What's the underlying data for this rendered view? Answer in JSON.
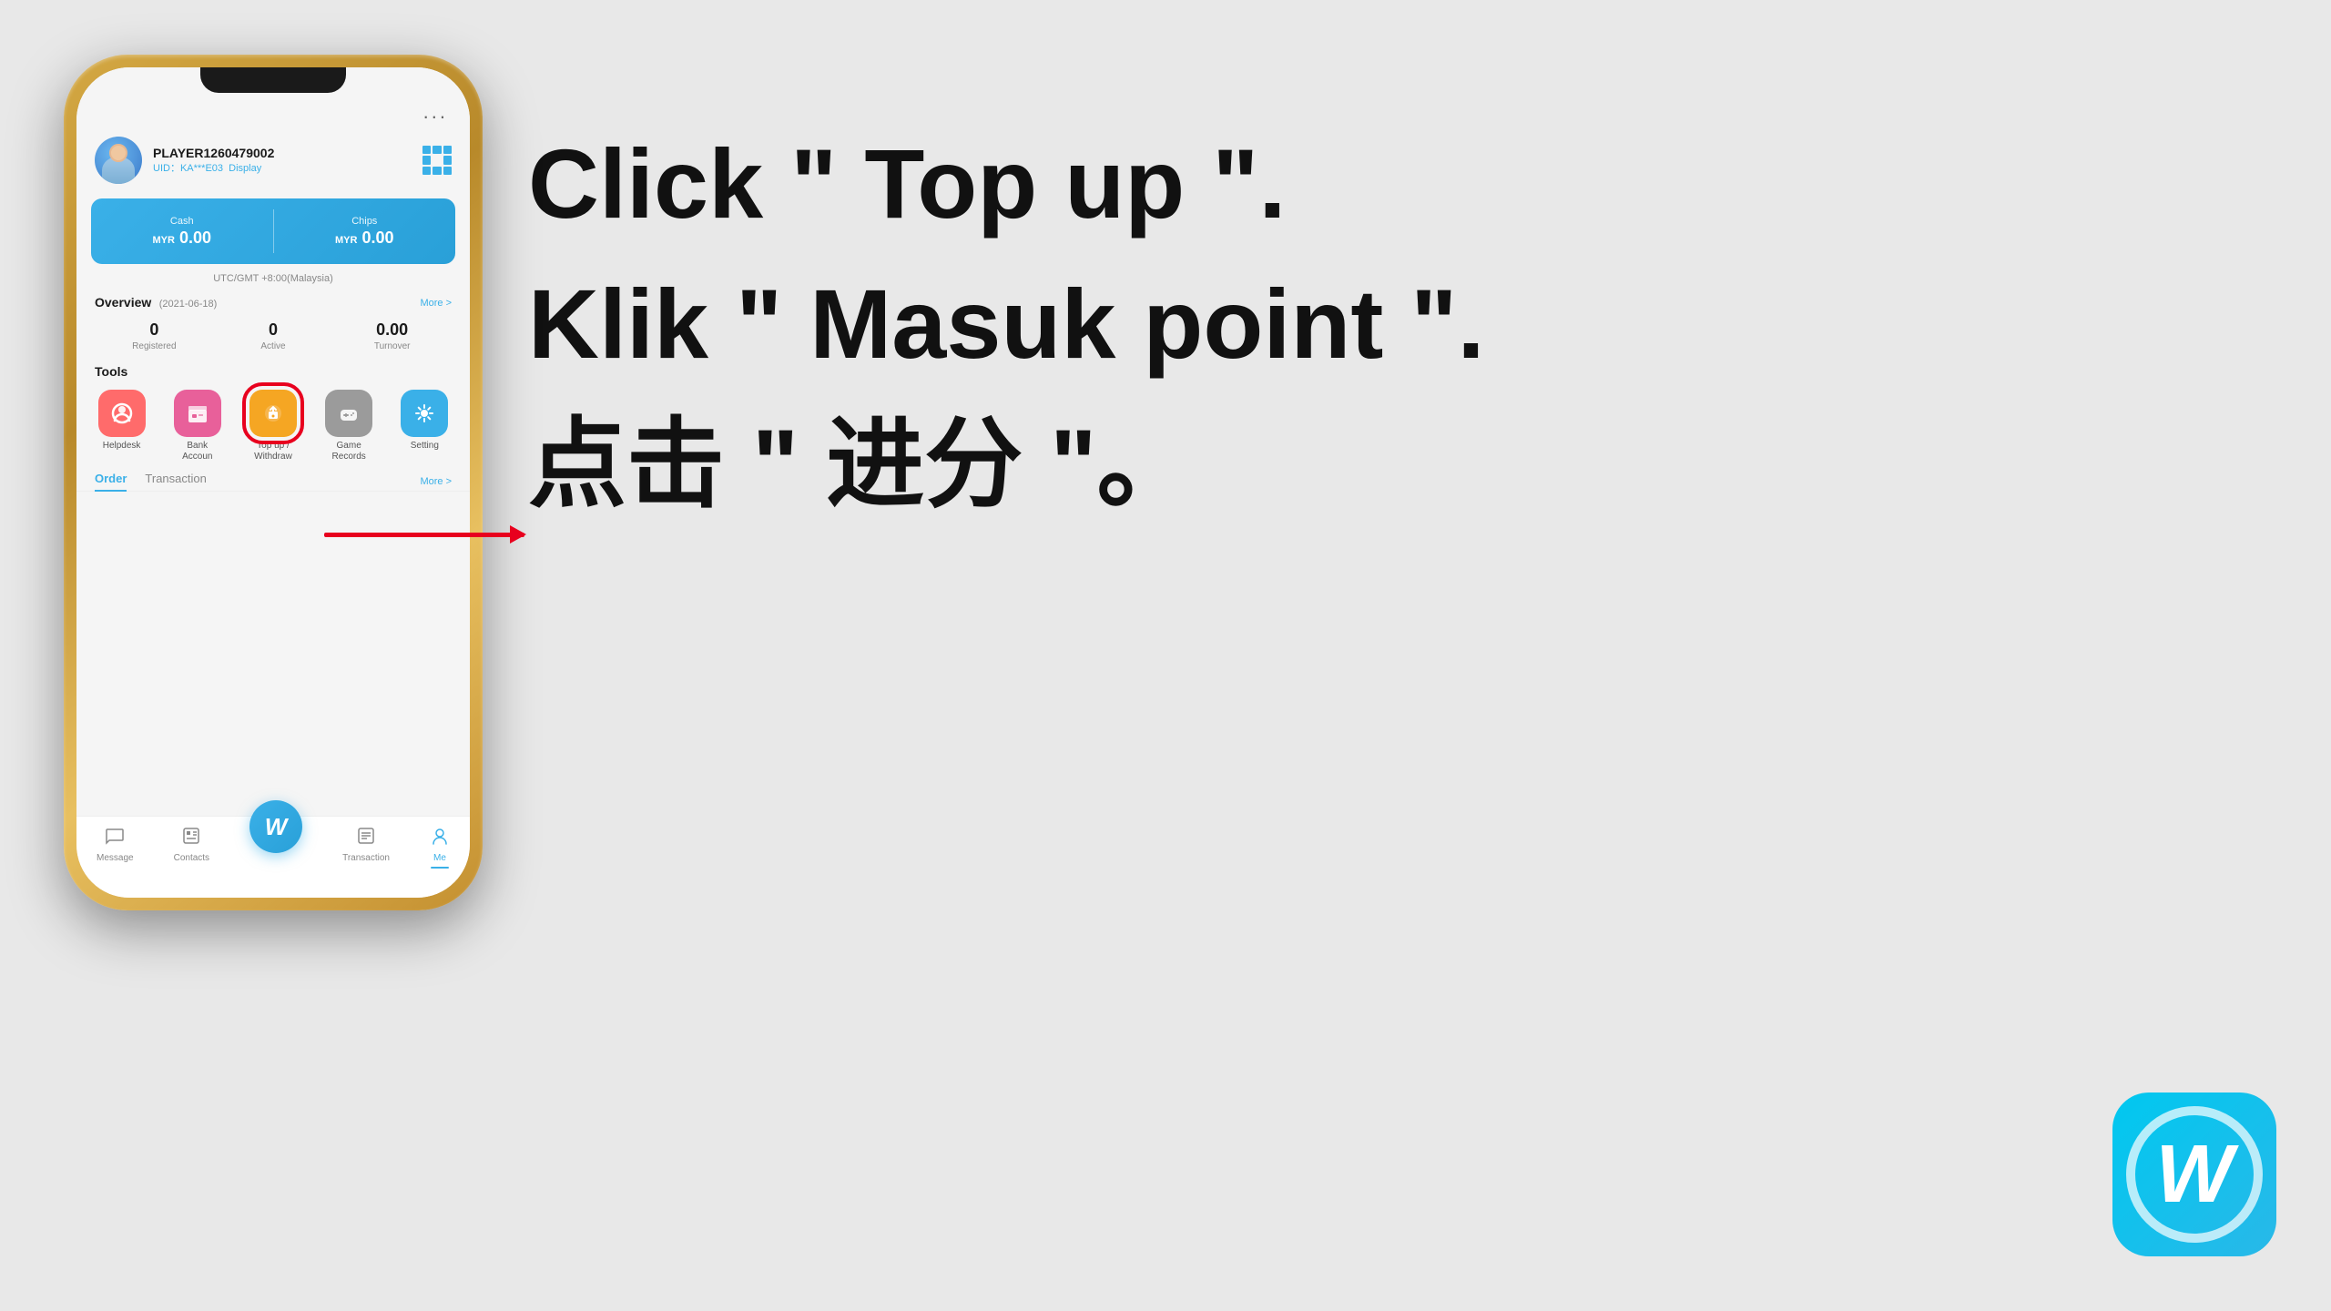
{
  "background": "#e8e8e8",
  "instructions": {
    "line1": "Click \" Top up \".",
    "line2": "Klik \" Masuk point \".",
    "line3": "点击 \" 进分 \"。"
  },
  "phone": {
    "menu_dots": "...",
    "profile": {
      "name": "PLAYER1260479002",
      "uid_label": "UID：KA***E03",
      "display": "Display"
    },
    "balance": {
      "cash_label": "Cash",
      "cash_currency": "MYR",
      "cash_amount": "0.00",
      "chips_label": "Chips",
      "chips_currency": "MYR",
      "chips_amount": "0.00",
      "timezone": "UTC/GMT +8:00(Malaysia)"
    },
    "overview": {
      "title": "Overview",
      "date": "(2021-06-18)",
      "more": "More >",
      "stats": [
        {
          "value": "0",
          "label": "Registered"
        },
        {
          "value": "0",
          "label": "Active"
        },
        {
          "value": "0.00",
          "label": "Turnover"
        }
      ]
    },
    "tools": {
      "title": "Tools",
      "items": [
        {
          "label": "Helpdesk",
          "emoji": "🔴",
          "color": "helpdesk"
        },
        {
          "label": "Bank Accoun",
          "emoji": "💳",
          "color": "bank"
        },
        {
          "label": "Top up / Withdraw",
          "emoji": "💰",
          "color": "topup"
        },
        {
          "label": "Game Records",
          "emoji": "🎮",
          "color": "game"
        },
        {
          "label": "Setting",
          "emoji": "⚙️",
          "color": "setting"
        }
      ]
    },
    "tabs": {
      "active": "Order",
      "items": [
        "Order",
        "Transaction"
      ],
      "more": "More >"
    },
    "bottom_nav": {
      "items": [
        {
          "icon": "💬",
          "label": "Message"
        },
        {
          "icon": "👥",
          "label": "Contacts"
        },
        {
          "icon": "W",
          "label": ""
        },
        {
          "icon": "📋",
          "label": "Transaction"
        },
        {
          "icon": "👤",
          "label": "Me",
          "active": true
        }
      ]
    }
  },
  "watermark": {
    "letter": "W"
  }
}
